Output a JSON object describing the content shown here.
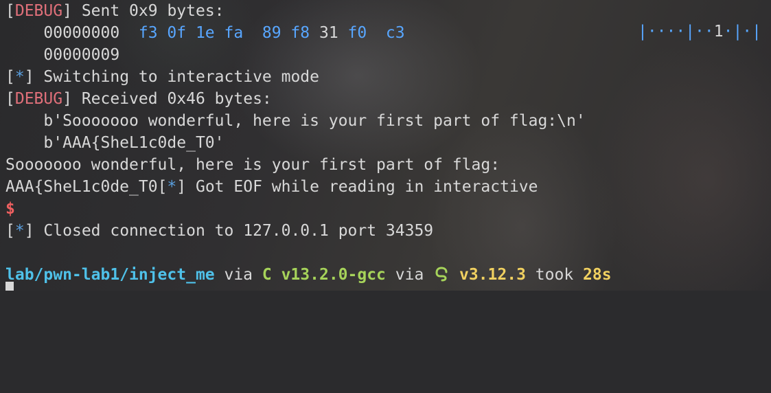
{
  "line1": {
    "open": "[",
    "tag": "DEBUG",
    "close": "]",
    "text": " Sent 0x9 bytes:"
  },
  "line2": {
    "indent": "    ",
    "offset": "00000000  ",
    "hex1": "f3 0f 1e fa  89 f8 ",
    "hex2": "31",
    "hex3": " f0  c3"
  },
  "line2_right": {
    "a": "|····|··",
    "b": "1",
    "c": "·|·|"
  },
  "line3": {
    "indent": "    ",
    "text": "00000009"
  },
  "line4": {
    "open": "[",
    "tag": "*",
    "close": "]",
    "text": " Switching to interactive mode"
  },
  "line5": {
    "open": "[",
    "tag": "DEBUG",
    "close": "]",
    "text": " Received 0x46 bytes:"
  },
  "line6": {
    "text": "    b'Sooooooo wonderful, here is your first part of flag:\\n'"
  },
  "line7": {
    "text": "    b'AAA{SheL1c0de_T0'"
  },
  "line8": {
    "text": "Sooooooo wonderful, here is your first part of flag:"
  },
  "line9": {
    "pre": "AAA{SheL1c0de_T0",
    "open": "[",
    "tag": "*",
    "close": "]",
    "text": " Got EOF while reading in interactive"
  },
  "line10": {
    "prompt": "$"
  },
  "line11": {
    "open": "[",
    "tag": "*",
    "close": "]",
    "text": " Closed connection to 127.0.0.1 port 34359"
  },
  "prompt_line": {
    "path": "lab/pwn-lab1/inject_me",
    "via1": " via ",
    "c_label": "C v13.2.0-gcc",
    "via2": " via ",
    "py_version": "v3.12.3",
    "took": " took ",
    "duration": "28s"
  },
  "colors": {
    "debug": "#e0707a",
    "info": "#5aa0e0",
    "hex": "#58a6ff",
    "path": "#4fc1e9",
    "c": "#a6d35a",
    "python": "#f0d060",
    "prompt": "#f06060"
  }
}
